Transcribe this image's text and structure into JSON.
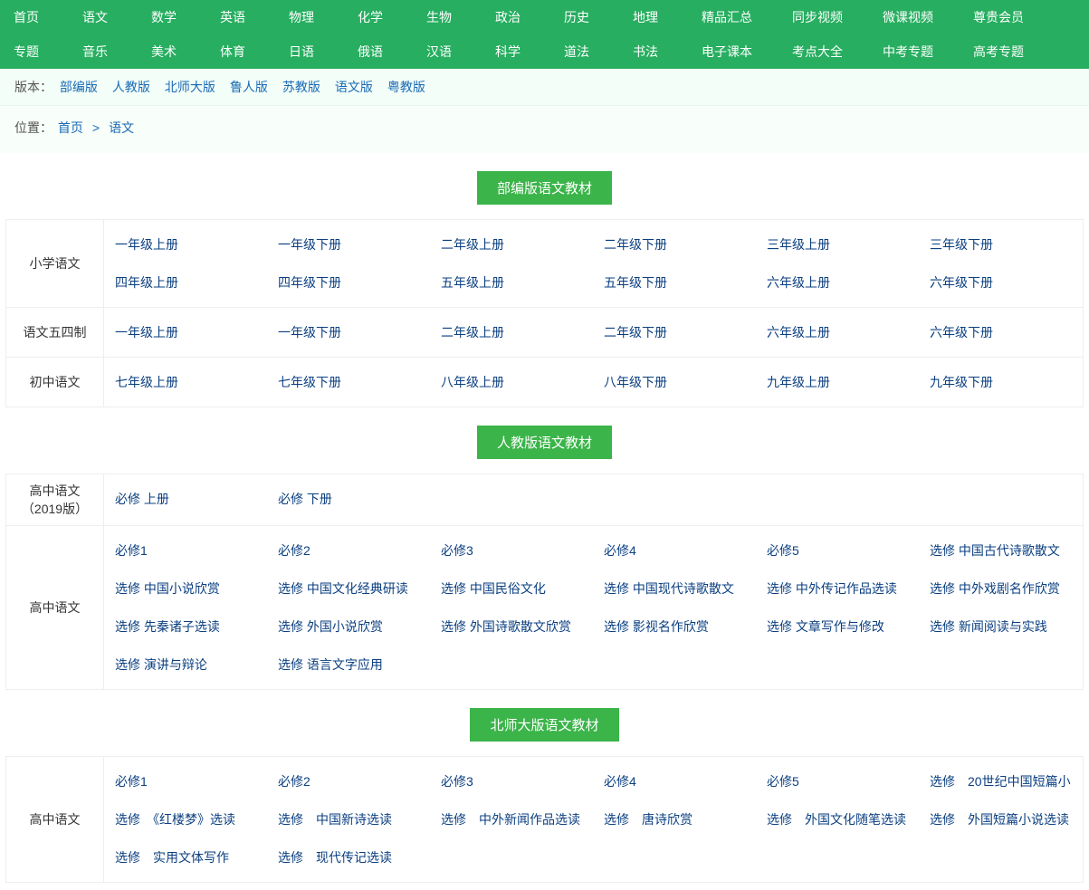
{
  "nav": {
    "row1": [
      "首页",
      "语文",
      "数学",
      "英语",
      "物理",
      "化学",
      "生物",
      "政治",
      "历史",
      "地理",
      "精品汇总",
      "同步视频",
      "微课视频",
      "尊贵会员"
    ],
    "row2": [
      "专题",
      "音乐",
      "美术",
      "体育",
      "日语",
      "俄语",
      "汉语",
      "科学",
      "道法",
      "书法",
      "电子课本",
      "考点大全",
      "中考专题",
      "高考专题"
    ]
  },
  "filter": {
    "label": "版本：",
    "items": [
      "部编版",
      "人教版",
      "北师大版",
      "鲁人版",
      "苏教版",
      "语文版",
      "粤教版"
    ]
  },
  "breadcrumb": {
    "label": "位置：",
    "items": [
      "首页",
      "语文"
    ]
  },
  "sections": [
    {
      "title": "部编版语文教材",
      "rows": [
        {
          "label": "小学语文",
          "items": [
            "一年级上册",
            "一年级下册",
            "二年级上册",
            "二年级下册",
            "三年级上册",
            "三年级下册",
            "四年级上册",
            "四年级下册",
            "五年级上册",
            "五年级下册",
            "六年级上册",
            "六年级下册"
          ]
        },
        {
          "label": "语文五四制",
          "items": [
            "一年级上册",
            "一年级下册",
            "二年级上册",
            "二年级下册",
            "六年级上册",
            "六年级下册"
          ]
        },
        {
          "label": "初中语文",
          "items": [
            "七年级上册",
            "七年级下册",
            "八年级上册",
            "八年级下册",
            "九年级上册",
            "九年级下册"
          ]
        }
      ]
    },
    {
      "title": "人教版语文教材",
      "rows": [
        {
          "label": "高中语文（2019版）",
          "items": [
            "必修 上册",
            "必修 下册"
          ]
        },
        {
          "label": "高中语文",
          "items": [
            "必修1",
            "必修2",
            "必修3",
            "必修4",
            "必修5",
            "选修 中国古代诗歌散文",
            "选修 中国小说欣赏",
            "选修 中国文化经典研读",
            "选修 中国民俗文化",
            "选修 中国现代诗歌散文",
            "选修 中外传记作品选读",
            "选修 中外戏剧名作欣赏",
            "选修 先秦诸子选读",
            "选修 外国小说欣赏",
            "选修 外国诗歌散文欣赏",
            "选修 影视名作欣赏",
            "选修 文章写作与修改",
            "选修 新闻阅读与实践",
            "选修 演讲与辩论",
            "选修 语言文字应用"
          ]
        }
      ]
    },
    {
      "title": "北师大版语文教材",
      "rows": [
        {
          "label": "高中语文",
          "items": [
            "必修1",
            "必修2",
            "必修3",
            "必修4",
            "必修5",
            "选修　20世纪中国短篇小",
            "选修　《红楼梦》选读",
            "选修　中国新诗选读",
            "选修　中外新闻作品选读",
            "选修　唐诗欣赏",
            "选修　外国文化随笔选读",
            "选修　外国短篇小说选读",
            "选修　实用文体写作",
            "选修　现代传记选读"
          ]
        }
      ]
    }
  ]
}
